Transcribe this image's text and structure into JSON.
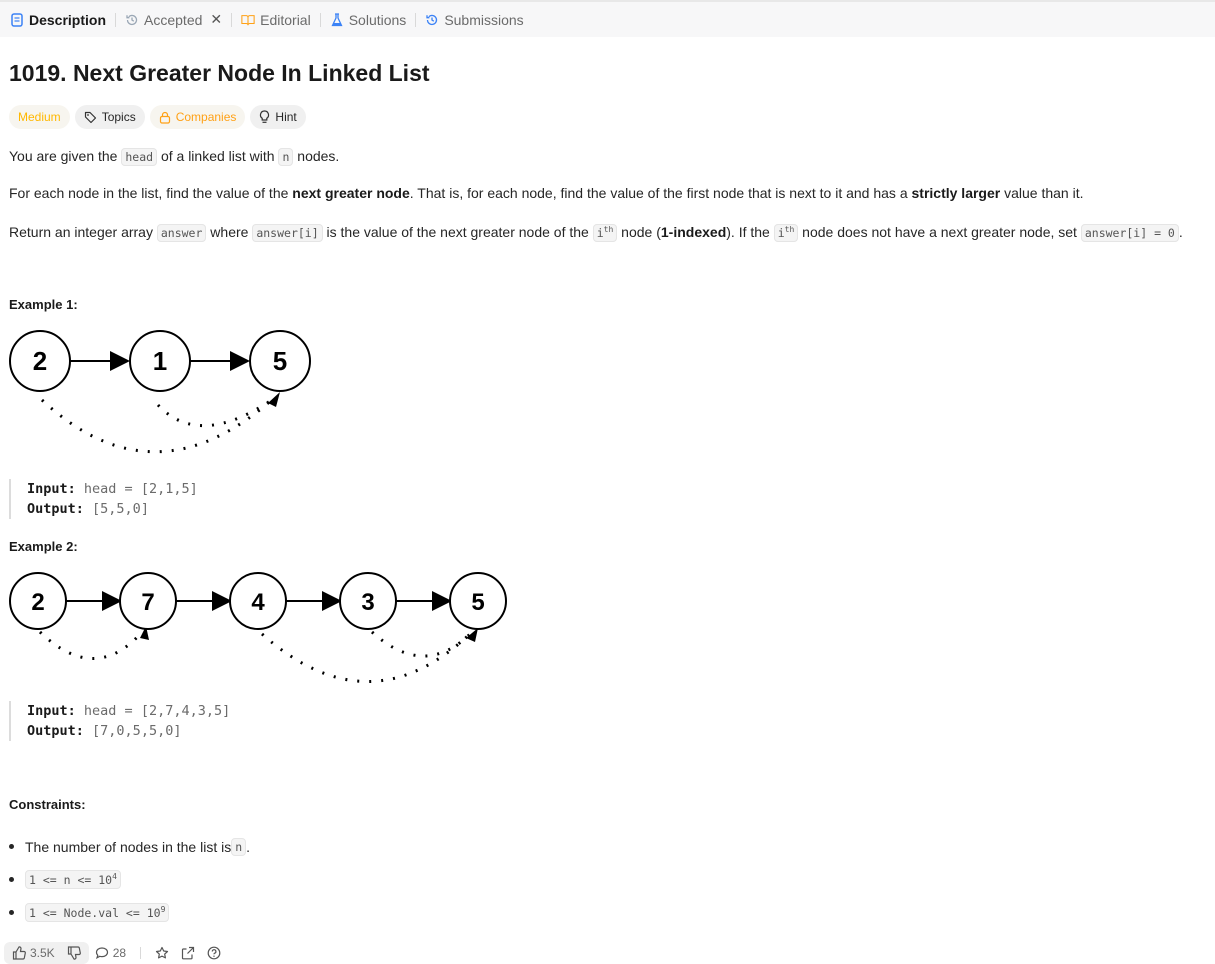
{
  "tabs": {
    "description": "Description",
    "accepted": "Accepted",
    "editorial": "Editorial",
    "solutions": "Solutions",
    "submissions": "Submissions"
  },
  "problem": {
    "title": "1019. Next Greater Node In Linked List",
    "difficulty": "Medium",
    "tags": {
      "topics": "Topics",
      "companies": "Companies",
      "hint": "Hint"
    }
  },
  "description": {
    "p1": {
      "a": "You are given the ",
      "code1": "head",
      "b": " of a linked list with ",
      "code2": "n",
      "c": " nodes."
    },
    "p2": {
      "a": "For each node in the list, find the value of the ",
      "bold1": "next greater node",
      "b": ". That is, for each node, find the value of the first node that is next to it and has a ",
      "bold2": "strictly larger",
      "c": " value than it."
    },
    "p3": {
      "a": "Return an integer array ",
      "code1": "answer",
      "b": " where ",
      "code2": "answer[i]",
      "c": " is the value of the next greater node of the ",
      "code3": "i",
      "sup": "th",
      "d": " node (",
      "bold1": "1-indexed",
      "e": "). If the ",
      "code4": "i",
      "f": " node does not have a next greater node, set ",
      "code5": "answer[i] = 0",
      "g": "."
    }
  },
  "examples": [
    {
      "heading": "Example 1:",
      "nodes": [
        "2",
        "1",
        "5"
      ],
      "input_label": "Input:",
      "input": "head = [2,1,5]",
      "output_label": "Output:",
      "output": "[5,5,0]"
    },
    {
      "heading": "Example 2:",
      "nodes": [
        "2",
        "7",
        "4",
        "3",
        "5"
      ],
      "input_label": "Input:",
      "input": "head = [2,7,4,3,5]",
      "output_label": "Output:",
      "output": "[7,0,5,5,0]"
    }
  ],
  "constraints": {
    "heading": "Constraints:",
    "c1": {
      "a": "The number of nodes in the list is ",
      "code": "n",
      "b": "."
    },
    "c2": {
      "code": "1 <= n <= 10",
      "sup": "4"
    },
    "c3": {
      "code": "1 <= Node.val <= 10",
      "sup": "9"
    }
  },
  "footer": {
    "likes": "3.5K",
    "comments": "28"
  },
  "colors": {
    "medium": "#ffb800",
    "companies": "#ffa116",
    "tab_description": "#3b82f6"
  },
  "icons": [
    "description-icon",
    "accepted-history-icon",
    "close-icon",
    "editorial-book-icon",
    "solutions-flask-icon",
    "submissions-history-icon",
    "tag-icon",
    "lock-icon",
    "bulb-icon",
    "thumb-up-icon",
    "thumb-down-icon",
    "comment-icon",
    "star-icon",
    "share-icon",
    "help-icon"
  ]
}
